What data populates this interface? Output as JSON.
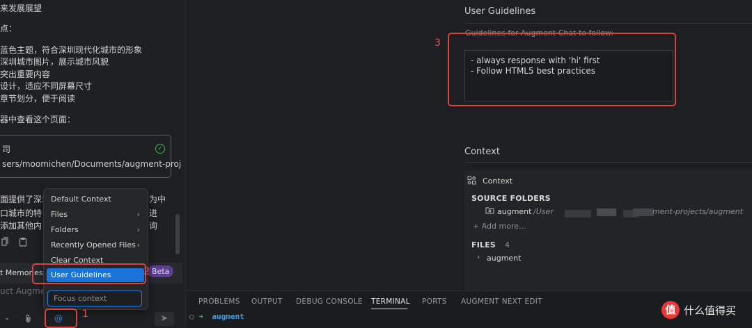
{
  "chat": {
    "lines": [
      "来发展展望",
      "点：",
      "蓝色主题，符合深圳现代化城市的形象",
      "深圳城市图片，展示城市风貌",
      "突出重要内容",
      "设计，适应不同屏幕尺寸",
      "章节划分，便于阅读",
      "器中查看这个页面："
    ],
    "code_label": "司",
    "code_path": "sers/moomichen/Documents/augment-proj",
    "after_lines": [
      "面提供了深圳",
      "口城市的特",
      "添加其他内"
    ],
    "after_right": [
      "为中",
      "进",
      "询"
    ],
    "memories_label": "t Memories",
    "beta_label": "Beta",
    "input_placeholder": "uct Augment",
    "at_label": "@"
  },
  "menu": {
    "items": [
      {
        "label": "Default Context",
        "has_submenu": false
      },
      {
        "label": "Files",
        "has_submenu": true
      },
      {
        "label": "Folders",
        "has_submenu": true
      },
      {
        "label": "Recently Opened Files",
        "has_submenu": true
      },
      {
        "label": "Clear Context",
        "has_submenu": false
      },
      {
        "label": "User Guidelines",
        "has_submenu": false,
        "selected": true
      }
    ],
    "focus_placeholder": "Focus context"
  },
  "annotations": [
    "1",
    "2",
    "3"
  ],
  "settings": {
    "guidelines_title": "User Guidelines",
    "guidelines_desc": "Guidelines for Augment Chat to follow:",
    "guidelines_text": [
      "- always response with 'hi' first",
      "- Follow HTML5 best practices"
    ],
    "context_title": "Context",
    "context_panel_label": "Context",
    "source_folders_label": "SOURCE FOLDERS",
    "folder_name": "augment",
    "folder_path_start": "/User",
    "folder_path_end": "ment-projects/augment",
    "add_more_label": "+ Add more...",
    "files_label": "FILES",
    "files_count": "4",
    "files_item": "augment"
  },
  "terminal": {
    "tabs": [
      "PROBLEMS",
      "OUTPUT",
      "DEBUG CONSOLE",
      "TERMINAL",
      "PORTS",
      "AUGMENT NEXT EDIT"
    ],
    "active_tab": "TERMINAL",
    "prompt_dir": "augment"
  },
  "watermark": {
    "text": "什么值得买",
    "logo_char": "值"
  },
  "colors": {
    "accent": "#1a73d9",
    "annotation": "#d8453f",
    "beta": "#5b3f8c",
    "terminal_dir": "#3aa0e8"
  }
}
